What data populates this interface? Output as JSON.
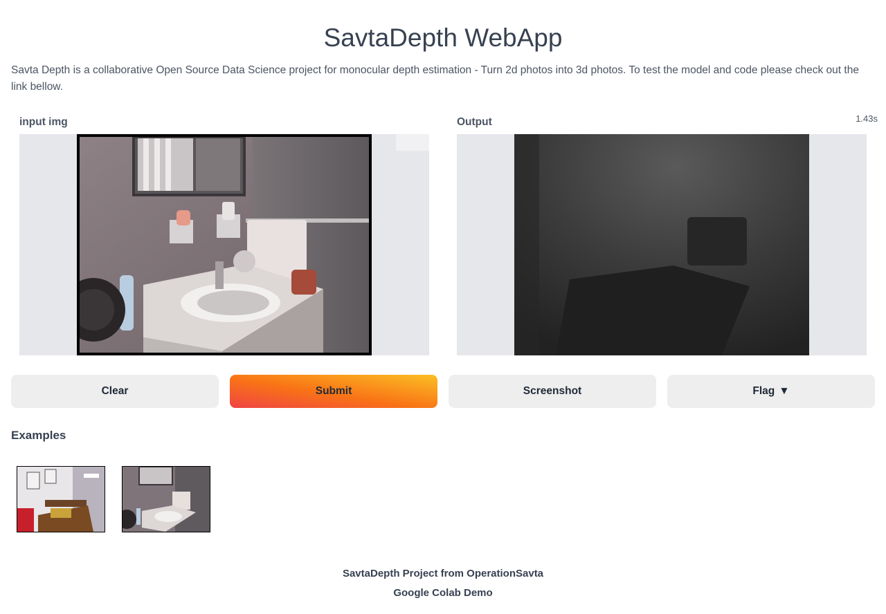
{
  "page": {
    "title": "SavtaDepth WebApp",
    "description": "Savta Depth is a collaborative Open Source Data Science project for monocular depth estimation - Turn 2d photos into 3d photos. To test the model and code please check out the link bellow."
  },
  "input_panel": {
    "label": "input img"
  },
  "output_panel": {
    "label": "Output",
    "timer": "1.43s"
  },
  "buttons": {
    "clear": "Clear",
    "submit": "Submit",
    "screenshot": "Screenshot",
    "flag": "Flag",
    "flag_icon": "▼"
  },
  "examples": {
    "title": "Examples"
  },
  "footer": {
    "line1": "SavtaDepth Project from OperationSavta",
    "line2": "Google Colab Demo"
  },
  "colors": {
    "submit_start": "#ef4444",
    "submit_end": "#fbbf24",
    "panel_bg": "#e5e7eb"
  }
}
